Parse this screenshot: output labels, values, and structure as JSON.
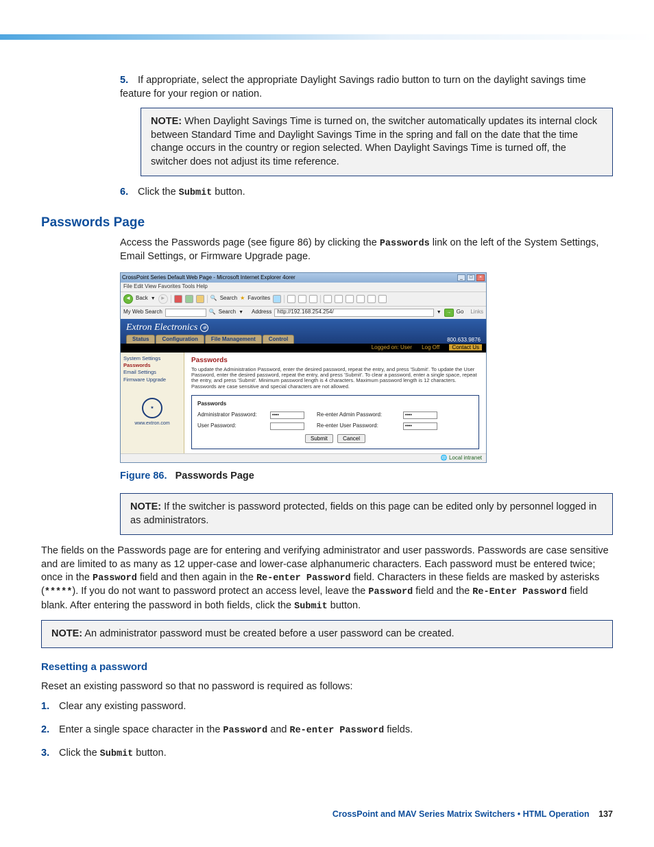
{
  "steps_top": [
    {
      "num": "5.",
      "text": "If appropriate, select the appropriate Daylight Savings radio button to turn on the daylight savings time feature for your region or nation."
    },
    {
      "num": "6.",
      "text_before": "Click the ",
      "mono": "Submit",
      "text_after": " button."
    }
  ],
  "note1": {
    "label": "NOTE:",
    "text": "When Daylight Savings Time is turned on, the switcher automatically updates its internal clock between Standard Time and Daylight Savings Time in the spring and fall on the date that the time change occurs in the country or region selected. When Daylight Savings Time is turned off, the switcher does not adjust its time reference."
  },
  "section_title": "Passwords Page",
  "intro_para": {
    "before": "Access the Passwords page (see figure 86) by clicking the ",
    "mono": "Passwords",
    "after": " link on the left of the System Settings, Email Settings, or Firmware Upgrade page."
  },
  "screenshot": {
    "title": "CrossPoint Series Default Web Page - Microsoft Internet Explorer 4orer",
    "menubar": "File   Edit   View   Favorites   Tools   Help",
    "back": "Back",
    "search": "Search",
    "favorites": "Favorites",
    "my_web_search": "My Web Search",
    "search2": "Search",
    "addr_label": "Address",
    "addr_value": "http://192.168.254.254/",
    "go": "Go",
    "links": "Links",
    "brand": "Extron Electronics",
    "tabs": [
      "Status",
      "Configuration",
      "File Management",
      "Control"
    ],
    "phone": "800.633.9876",
    "userbar": {
      "logged": "Logged on: User",
      "logoff": "Log Off",
      "contact": "Contact Us"
    },
    "sidebar": [
      "System Settings",
      "Passwords",
      "Email Settings",
      "Firmware Upgrade"
    ],
    "sidebar_selected_idx": 1,
    "side_url": "www.extron.com",
    "main_title": "Passwords",
    "main_intro": "To update the Administration Password, enter the desired password, repeat the entry, and press 'Submit'. To update the User Password, enter the desired password, repeat the entry, and press 'Submit'. To clear a password, enter a single space, repeat the entry, and press 'Submit'. Minimum password length is 4 characters. Maximum password length is 12 characters. Passwords are case sensitive and special characters are not allowed.",
    "panel_header": "Passwords",
    "row1": {
      "l": "Administrator Password:",
      "r": "Re-enter Admin Password:",
      "v": "••••"
    },
    "row2": {
      "l": "User Password:",
      "r": "Re-enter User Password:",
      "v": "••••"
    },
    "btn_submit": "Submit",
    "btn_cancel": "Cancel",
    "status": "Local intranet"
  },
  "fig_caption": {
    "num": "Figure 86.",
    "title": "Passwords Page"
  },
  "note2": {
    "label": "NOTE:",
    "text": "If the switcher is password protected, fields on this page can be edited only by personnel logged in as administrators."
  },
  "body_para_parts": {
    "p1": "The fields on the Passwords page are for entering and verifying administrator and user passwords. Passwords are case sensitive and are limited to as many as 12 upper-case and lower-case alphanumeric characters. Each password must be entered twice; once in the ",
    "m1": "Password",
    "p2": " field and then again in the ",
    "m2": "Re-enter Password",
    "p3": " field. Characters in these fields are masked by asterisks (",
    "m3": "*****",
    "p4": "). If you do not want to password protect an access level, leave the ",
    "m4": "Password",
    "p5": " field and the ",
    "m5": "Re-Enter Password",
    "p6": " field blank. After entering the password in both fields, click the ",
    "m6": "Submit",
    "p7": " button."
  },
  "note3": {
    "label": "NOTE:",
    "text": "An administrator password must be created before a user password can be created."
  },
  "subsection_title": "Resetting a password",
  "reset_intro": "Reset an existing password so that no password is required as follows:",
  "reset_steps": {
    "s1": {
      "num": "1.",
      "text": "Clear any existing password."
    },
    "s2": {
      "num": "2.",
      "before": "Enter a single space character in the ",
      "m1": "Password",
      "mid": " and ",
      "m2": "Re-enter Password",
      "after": " fields."
    },
    "s3": {
      "num": "3.",
      "before": "Click the ",
      "m1": "Submit",
      "after": " button."
    }
  },
  "footer": {
    "title": "CrossPoint and MAV Series Matrix Switchers • HTML Operation",
    "page": "137"
  }
}
